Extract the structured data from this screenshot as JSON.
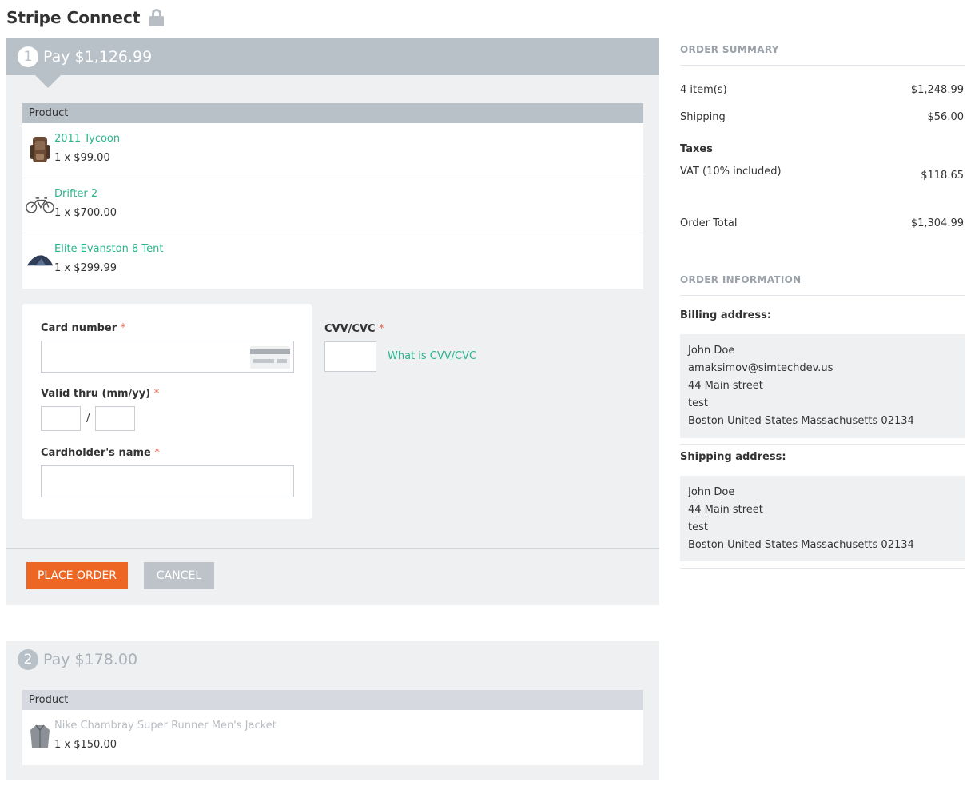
{
  "page": {
    "title": "Stripe Connect"
  },
  "step1": {
    "number": "1",
    "title": "Pay $1,126.99",
    "product_header": "Product",
    "products": [
      {
        "name": "2011 Tycoon",
        "price": "1 x $99.00",
        "icon": "backpack-icon"
      },
      {
        "name": "Drifter 2",
        "price": "1 x $700.00",
        "icon": "bicycle-icon"
      },
      {
        "name": "Elite Evanston 8 Tent",
        "price": "1 x $299.99",
        "icon": "tent-icon"
      }
    ],
    "form": {
      "card_number_label": "Card number",
      "valid_thru_label": "Valid thru (mm/yy)",
      "slash": "/",
      "cardholder_label": "Cardholder's name",
      "cvv_label": "CVV/CVC",
      "cvv_link": "What is CVV/CVC",
      "required_mark": "*"
    },
    "place_order": "Place order",
    "cancel": "Cancel"
  },
  "step2": {
    "number": "2",
    "title": "Pay $178.00",
    "product_header": "Product",
    "products": [
      {
        "name": "Nike Chambray Super Runner Men's Jacket",
        "price": "1 x $150.00",
        "icon": "jacket-icon"
      }
    ]
  },
  "summary": {
    "title": "Order summary",
    "items_label": "4 item(s)",
    "items_value": "$1,248.99",
    "shipping_label": "Shipping",
    "shipping_value": "$56.00",
    "taxes_label": "Taxes",
    "vat_label": "VAT (10% included)",
    "vat_value": "$118.65",
    "total_label": "Order Total",
    "total_value": "$1,304.99"
  },
  "order_info": {
    "title": "Order information",
    "billing_label": "Billing address:",
    "billing": {
      "name": "John  Doe",
      "email": "amaksimov@simtechdev.us",
      "street": "44 Main street",
      "line2": "test",
      "city_line": "Boston  United States  Massachusetts  02134"
    },
    "shipping_label": "Shipping address:",
    "shipping": {
      "name": "John  Doe",
      "street": "44 Main street",
      "line2": "test",
      "city_line": "Boston  United States  Massachusetts  02134"
    }
  },
  "colors": {
    "accent_green": "#2bb58b",
    "place_order_orange": "#ee6624",
    "header_gray": "#b8c0c8"
  }
}
